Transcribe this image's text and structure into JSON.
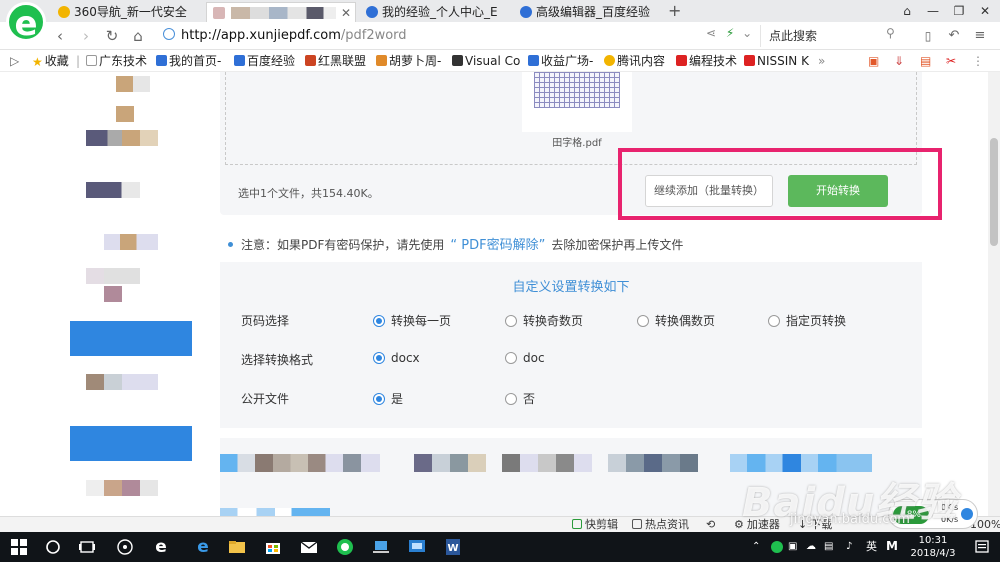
{
  "browser": {
    "tabs": [
      {
        "label": "360导航_新一代安全",
        "active": false,
        "favicon_color": "#f2b400"
      },
      {
        "label": "",
        "active": true,
        "favicon_color": "#d8b6b6"
      },
      {
        "label": "我的经验_个人中心_E",
        "active": false,
        "favicon_color": "#2f6fd6"
      },
      {
        "label": "高级编辑器_百度经验",
        "active": false,
        "favicon_color": "#2f6fd6"
      }
    ],
    "url_domain": "http://app.xunjiepdf.com",
    "url_path": "/pdf2word",
    "search_placeholder": "点此搜索"
  },
  "bookmarks": [
    "收藏",
    "广东技术",
    "我的首页-",
    "百度经验",
    "红黑联盟",
    "胡萝卜周-",
    "Visual Co",
    "收益广场-",
    "腾讯内容",
    "编程技术",
    "NISSIN K"
  ],
  "upload": {
    "file_name": "田字格.pdf",
    "selection_info": "选中1个文件，共154.40K。",
    "add_button": "继续添加（批量转换）",
    "start_button": "开始转换"
  },
  "note": {
    "prefix": "注意：如果PDF有密码保护，请先使用",
    "link": "“ PDF密码解除”",
    "suffix": "去除加密保护再上传文件"
  },
  "settings": {
    "title": "自定义设置转换如下",
    "rows": [
      {
        "label": "页码选择",
        "options": [
          "转换每一页",
          "转换奇数页",
          "转换偶数页",
          "指定页转换"
        ],
        "selected": 0
      },
      {
        "label": "选择转换格式",
        "options": [
          "docx",
          "doc"
        ],
        "selected": 0
      },
      {
        "label": "公开文件",
        "options": [
          "是",
          "否"
        ],
        "selected": 0
      }
    ]
  },
  "statusbar": {
    "items": [
      "快剪辑",
      "热点资讯",
      "加速器",
      "下载"
    ],
    "zoom": "100%",
    "speed_percent": "48%",
    "up": "0K/s",
    "down": "0K/s"
  },
  "taskbar": {
    "time": "10:31",
    "date": "2018/4/3",
    "ime": "英"
  },
  "watermark": {
    "text": "Baidu经验",
    "url": "jingyan.baidu.com"
  },
  "colors": {
    "accent_blue": "#2f86e0",
    "start_green": "#5cb85c",
    "highlight_pink": "#e8236e",
    "link_blue": "#3f8fd6"
  }
}
